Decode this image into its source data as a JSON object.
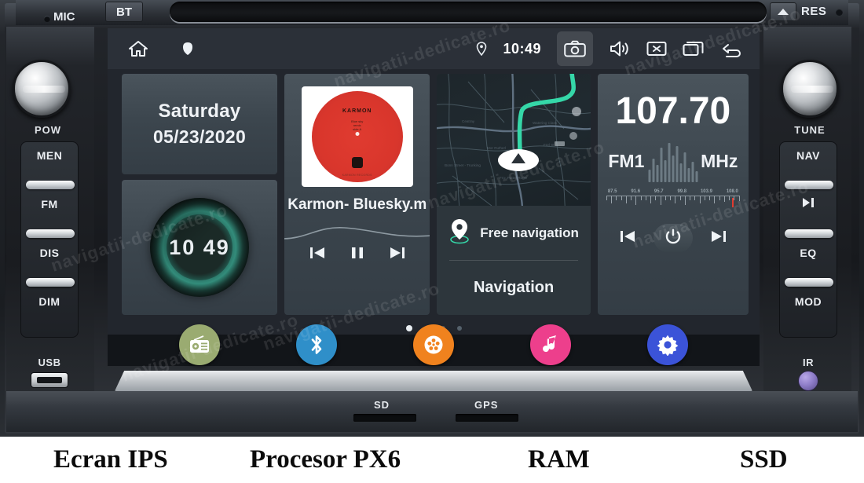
{
  "device": {
    "top_bezel": {
      "mic_label": "MIC",
      "bt_label": "BT",
      "res_label": "RES",
      "eject_icon": "eject-icon",
      "disc_slot": "cd-disc-slot"
    },
    "left_panel": {
      "knob_label": "POW",
      "buttons": [
        "MEN",
        "FM",
        "DIS",
        "DIM"
      ],
      "usb_label": "USB"
    },
    "right_panel": {
      "knob_label": "TUNE",
      "buttons": [
        "NAV",
        "PLAY/PAUSE",
        "EQ",
        "MOD"
      ],
      "ir_label": "IR"
    },
    "bottom_slots": [
      {
        "label": "SD"
      },
      {
        "label": "GPS"
      }
    ]
  },
  "screen": {
    "statusbar": {
      "home_icon": "home-icon",
      "recent_dot_icon": "dot-icon",
      "location_icon": "location-pin-icon",
      "time": "10:49",
      "screenshot_icon": "camera-icon",
      "volume_icon": "speaker-icon",
      "mute_icon": "screen-off-icon",
      "apps_icon": "multiwindow-icon",
      "back_icon": "back-arrow-icon"
    },
    "tiles": {
      "date": {
        "day_of_week": "Saturday",
        "date": "05/23/2020"
      },
      "clock": {
        "time": "10 49",
        "ring_color": "#2f7a6c"
      },
      "music": {
        "album_brand": "KARMON",
        "album_lines": "Blue sky\nremix\nside A",
        "album_footer": "KARMON RECORDS",
        "track_title": "Karmon- Bluesky.m",
        "prev_icon": "previous-track-icon",
        "pause_icon": "pause-icon",
        "next_icon": "next-track-icon"
      },
      "navigation": {
        "map_icon": "map-thumbnail",
        "position_icon": "navigation-arrow-icon",
        "free_nav_label": "Free navigation",
        "free_nav_icon": "location-pin-icon",
        "nav_label": "Navigation",
        "route_color": "#35d7a8"
      },
      "radio": {
        "frequency": "107.70",
        "band": "FM1",
        "unit": "MHz",
        "scale_ticks": [
          "87.5",
          "91.6",
          "95.7",
          "99.8",
          "103.9",
          "108.0"
        ],
        "prev_icon": "seek-down-icon",
        "power_icon": "power-icon",
        "next_icon": "seek-up-icon",
        "needle_color": "#e03b30"
      }
    },
    "page_dots": {
      "count": 4,
      "active_index": 0
    },
    "dock": [
      {
        "name": "radio-app",
        "icon": "radio-icon",
        "color": "#9aab71"
      },
      {
        "name": "bluetooth-app",
        "icon": "bluetooth-icon",
        "color": "#2f8fc9"
      },
      {
        "name": "video-app",
        "icon": "film-reel-icon",
        "color": "#f0821e"
      },
      {
        "name": "music-app",
        "icon": "music-note-icon",
        "color": "#ed3f8c"
      },
      {
        "name": "settings-app",
        "icon": "gear-icon",
        "color": "#3b53d8"
      }
    ]
  },
  "caption": {
    "items": [
      "Ecran IPS",
      "Procesor PX6",
      "RAM",
      "SSD"
    ]
  },
  "watermark": {
    "text": "navigatii-dedicate.ro"
  }
}
